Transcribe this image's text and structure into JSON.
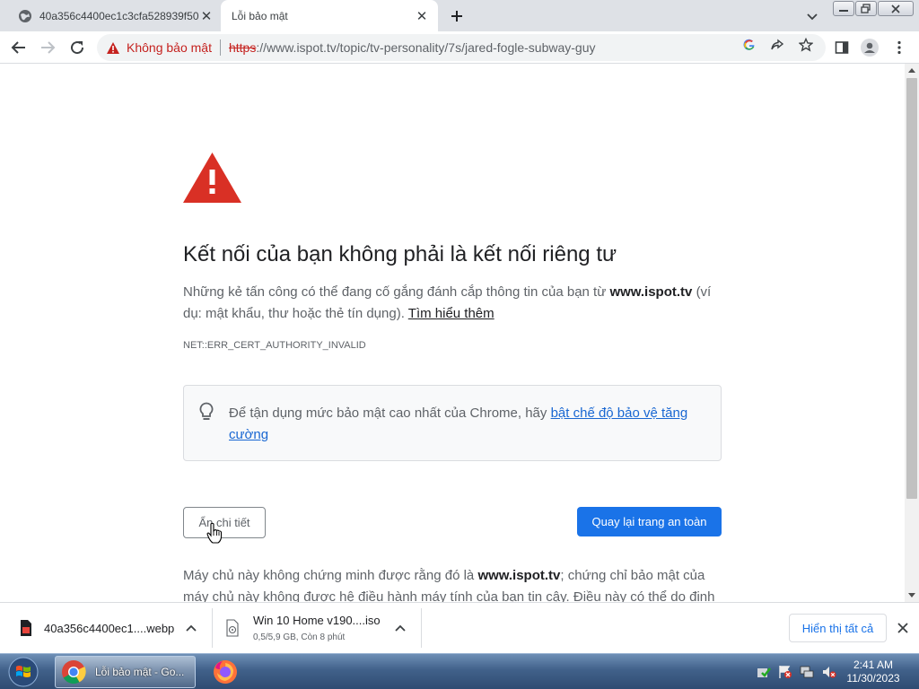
{
  "browser": {
    "tabs": [
      {
        "title": "40a356c4400ec1c3cfa528939f50c",
        "favicon": "globe-icon",
        "active": false
      },
      {
        "title": "Lỗi bảo mật",
        "favicon": "none",
        "active": true
      }
    ],
    "omnibox": {
      "security_label": "Không bảo mật",
      "scheme": "https",
      "url_rest": "://www.ispot.tv/topic/tv-personality/7s/jared-fogle-subway-guy"
    }
  },
  "page": {
    "heading": "Kết nối của bạn không phải là kết nối riêng tư",
    "desc_prefix": "Những kẻ tấn công có thể đang cố gắng đánh cắp thông tin của bạn từ",
    "desc_domain": "www.ispot.tv",
    "desc_suffix": "(ví dụ: mật khẩu, thư hoặc thẻ tín dụng).",
    "learn_more": "Tìm hiểu thêm",
    "error_code": "NET::ERR_CERT_AUTHORITY_INVALID",
    "tip_prefix": "Để tận dụng mức bảo mật cao nhất của Chrome, hãy",
    "tip_link": "bật chế độ bảo vệ tăng cường",
    "details_button": "Ẩn chi tiết",
    "back_button": "Quay lại trang an toàn",
    "more_prefix": "Máy chủ này không chứng minh được rằng đó là",
    "more_domain": "www.ispot.tv",
    "more_suffix": "; chứng chỉ bảo mật của máy chủ này không được hệ điều hành máy tính của bạn tin cậy. Điều này có thể do định"
  },
  "downloads": {
    "items": [
      {
        "name": "40a356c4400ec1....webp",
        "status": ""
      },
      {
        "name": "Win 10 Home v190....iso",
        "status": "0,5/5,9 GB, Còn 8 phút"
      }
    ],
    "show_all": "Hiển thị tất cả"
  },
  "taskbar": {
    "chrome_label": "Lỗi bảo mật - Go...",
    "time": "2:41 AM",
    "date": "11/30/2023"
  },
  "colors": {
    "primary_blue": "#1a73e8",
    "danger_red": "#d93025",
    "link_blue": "#1967d2"
  }
}
